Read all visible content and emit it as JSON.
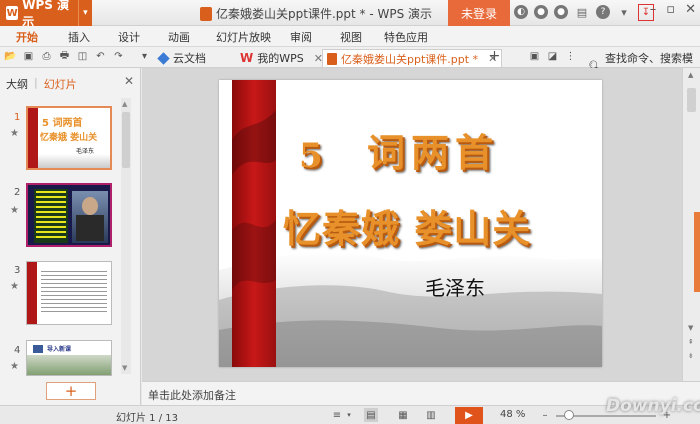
{
  "titlebar": {
    "app_name": "WPS 演示",
    "app_logo": "W",
    "doc_title": "亿秦娥娄山关ppt课件.ppt * - WPS 演示",
    "login_label": "未登录"
  },
  "menu": {
    "items": [
      "开始",
      "插入",
      "设计",
      "动画",
      "幻灯片放映",
      "审阅",
      "视图",
      "特色应用"
    ]
  },
  "tabs": {
    "cloud_docs": "云文档",
    "my_wps": "我的WPS",
    "current_doc": "亿秦娥娄山关ppt课件.ppt *",
    "search_cmd": "查找命令、搜索模板"
  },
  "left_panel": {
    "tab_outline": "大纲",
    "tab_slides": "幻灯片",
    "thumb_numbers": [
      "1",
      "2",
      "3",
      "4"
    ],
    "thumb1_line1": "5 词两首",
    "thumb1_line2": "忆秦娥 娄山关",
    "thumb1_author": "毛泽东",
    "thumb4_title": "导入新课",
    "add_symbol": "+"
  },
  "slide": {
    "line1_num": "5",
    "line1_text": "词两首",
    "line2_text": "忆秦娥 娄山关",
    "author": "毛泽东"
  },
  "notes_placeholder": "单击此处添加备注",
  "status": {
    "slide_counter": "幻灯片 1 / 13",
    "zoom": "48 %",
    "zoom_level_fraction": 0.48
  },
  "watermark": "Downyi.com",
  "colors": {
    "brand_orange": "#d9601c",
    "title_orange": "#e8912a"
  }
}
